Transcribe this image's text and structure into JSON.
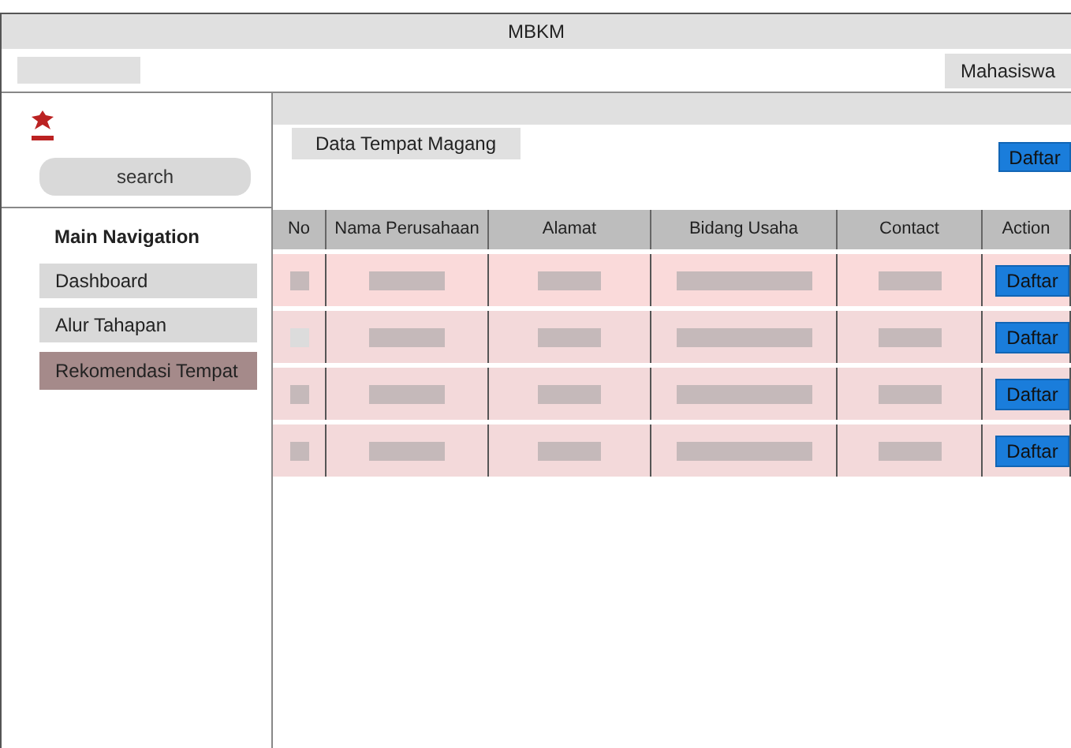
{
  "window": {
    "title": "MBKM"
  },
  "top_bar": {
    "user": "Mahasiswa"
  },
  "sidebar": {
    "search": {
      "placeholder": "search"
    },
    "heading": "Main Navigation",
    "items": [
      {
        "label": "Dashboard",
        "selected": false
      },
      {
        "label": "Alur Tahapan",
        "selected": false
      },
      {
        "label": "Rekomendasi Tempat",
        "selected": true
      }
    ]
  },
  "main": {
    "section_title": "Data Tempat Magang",
    "add_button": "Daftar",
    "table": {
      "columns": [
        "No",
        "Nama Perusahaan",
        "Alamat",
        "Bidang Usaha",
        "Contact",
        "Action"
      ],
      "rows": [
        {
          "action": "Daftar"
        },
        {
          "action": "Daftar"
        },
        {
          "action": "Daftar"
        },
        {
          "action": "Daftar"
        }
      ]
    }
  }
}
